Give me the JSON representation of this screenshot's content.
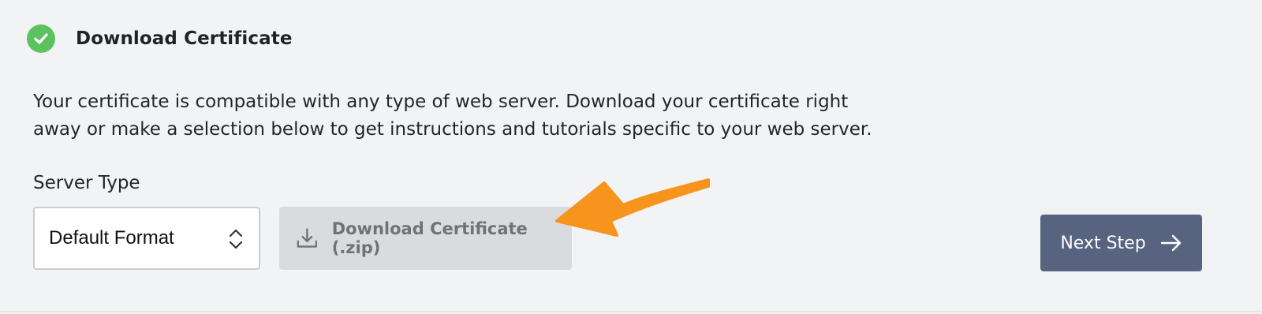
{
  "step": {
    "title": "Download Certificate",
    "status_icon": "check-circle-icon",
    "status_color": "#5cc15f"
  },
  "description": "Your certificate is compatible with any type of web server. Download your certificate right away or make a selection below to get instructions and tutorials specific to your web server.",
  "server_type": {
    "label": "Server Type",
    "selected": "Default Format",
    "icon": "chevron-updown-icon"
  },
  "download": {
    "label": "Download Certificate (.zip)",
    "icon": "download-icon",
    "background": "#d9dbdf"
  },
  "annotation": {
    "icon": "arrow-pointer-icon",
    "color": "#f7941d"
  },
  "next": {
    "label": "Next Step",
    "icon": "arrow-right-icon",
    "background": "#586380"
  }
}
